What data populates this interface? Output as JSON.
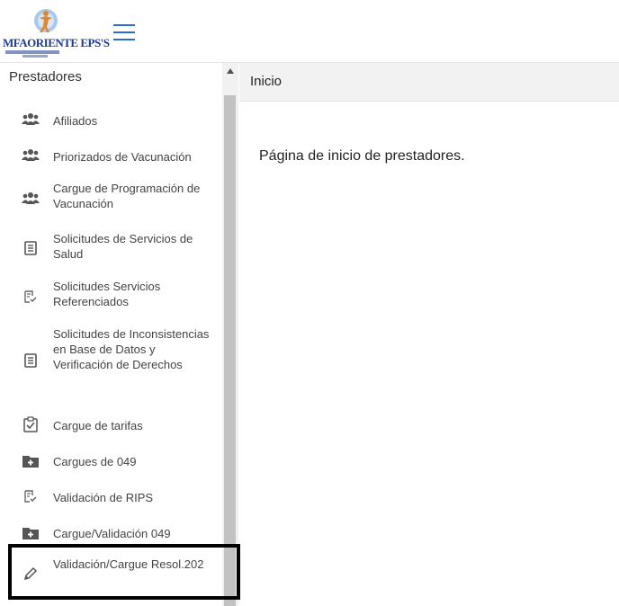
{
  "header": {
    "logo_text": "MFAORIENTE EPS'S",
    "menu_icon": "hamburger-menu-icon"
  },
  "sidebar": {
    "title": "Prestadores",
    "items": [
      {
        "label": "Afiliados",
        "icon": "users-icon"
      },
      {
        "label": "Priorizados de Vacunación",
        "icon": "users-icon"
      },
      {
        "label": "Cargue de Programación de Vacunación",
        "icon": "users-icon"
      },
      {
        "label": "Solicitudes de Servicios de Salud",
        "icon": "document-list-icon"
      },
      {
        "label": "Solicitudes Servicios Referenciados",
        "icon": "document-check-icon"
      },
      {
        "label": "Solicitudes de Inconsistencias en Base de Datos y Verificación de Derechos",
        "icon": "document-list-icon"
      },
      {
        "label": "Cargue de tarifas",
        "icon": "clipboard-check-icon"
      },
      {
        "label": "Cargues de 049",
        "icon": "folder-plus-icon"
      },
      {
        "label": "Validación de RIPS",
        "icon": "document-check-icon"
      },
      {
        "label": "Cargue/Validación 049",
        "icon": "folder-plus-icon"
      },
      {
        "label": "Validación/Cargue Resol.202",
        "icon": "pencil-icon"
      }
    ]
  },
  "main": {
    "breadcrumb": "Inicio",
    "welcome_text": "Página de inicio de prestadores."
  }
}
